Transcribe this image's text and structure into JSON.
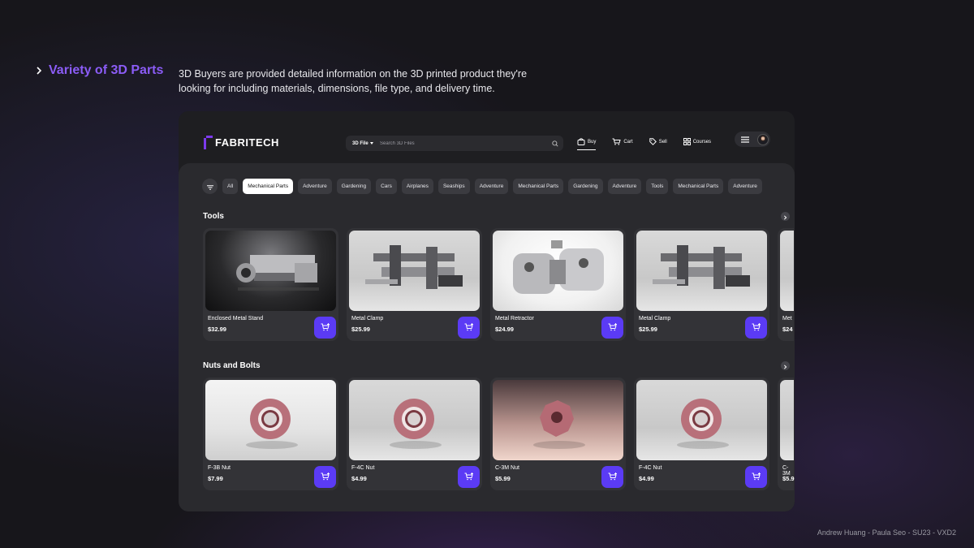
{
  "slide": {
    "heading": "Variety of 3D Parts",
    "description": "3D Buyers are provided detailed information on the 3D printed product they're looking for including materials, dimensions, file type, and delivery time.",
    "footer": "Andrew Huang - Paula Seo - SU23 - VXD2"
  },
  "app": {
    "logo": "FABRITECH",
    "search": {
      "type": "3D File",
      "placeholder": "Search 3D Files"
    },
    "nav": [
      {
        "label": "Buy",
        "icon": "bag-icon",
        "active": true
      },
      {
        "label": "Cart",
        "icon": "cart-icon"
      },
      {
        "label": "Sell",
        "icon": "tag-icon"
      },
      {
        "label": "Courses",
        "icon": "grid-icon"
      }
    ],
    "chips": [
      "All",
      "Mechanical Parts",
      "Adventure",
      "Gardening",
      "Cars",
      "Airplanes",
      "Seaships",
      "Adventure",
      "Mechanical Parts",
      "Gardening",
      "Adventure",
      "Tools",
      "Mechanical Parts",
      "Adventure"
    ],
    "active_chip": "Mechanical Parts",
    "sections": [
      {
        "title": "Tools",
        "products": [
          {
            "name": "Enclosed Metal Stand",
            "price": "$32.99"
          },
          {
            "name": "Metal Clamp",
            "price": "$25.99"
          },
          {
            "name": "Metal Retractor",
            "price": "$24.99"
          },
          {
            "name": "Metal Clamp",
            "price": "$25.99"
          },
          {
            "name": "Met",
            "price": "$24"
          }
        ]
      },
      {
        "title": "Nuts and Bolts",
        "products": [
          {
            "name": "F-3B Nut",
            "price": "$7.99"
          },
          {
            "name": "F-4C Nut",
            "price": "$4.99"
          },
          {
            "name": "C-3M Nut",
            "price": "$5.99"
          },
          {
            "name": "F-4C Nut",
            "price": "$4.99"
          },
          {
            "name": "C-3M",
            "price": "$5.9"
          }
        ]
      }
    ]
  },
  "colors": {
    "accent": "#8b5cf6",
    "cart_button": "#5b3bf5",
    "frame": "#1e1e21",
    "content": "#2a2a2e"
  }
}
